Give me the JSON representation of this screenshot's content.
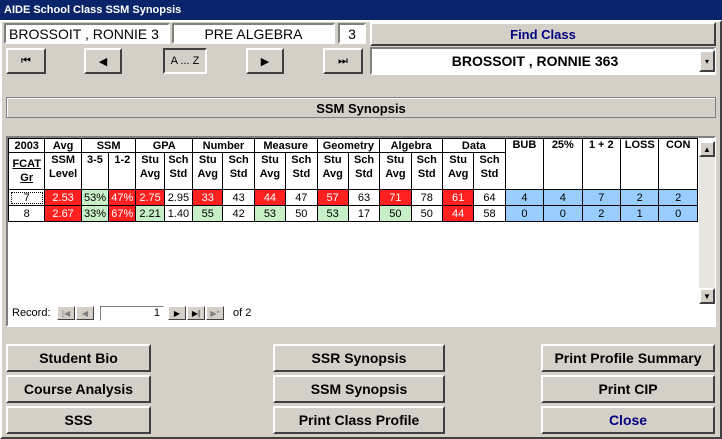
{
  "window": {
    "title": "AIDE School Class SSM Synopsis"
  },
  "header": {
    "student": "BROSSOIT , RONNIE 3",
    "course": "PRE ALGEBRA",
    "period": "3",
    "find_class": "Find Class"
  },
  "nav": {
    "first": "⏮",
    "prev": "◀",
    "alpha": "A ... Z",
    "next": "▶",
    "last": "⏭"
  },
  "student_select": {
    "value": "BROSSOIT , RONNIE 363",
    "arrow": "▾"
  },
  "section": {
    "title": "SSM Synopsis"
  },
  "table": {
    "top_headers": [
      "2003",
      "Avg",
      "SSM",
      "GPA",
      "Number",
      "Measure",
      "Geometry",
      "Algebra",
      "Data",
      "BUB",
      "25%",
      "1 + 2",
      "LOSS",
      "CON"
    ],
    "avg_sub": "SSM\nLevel",
    "fcat": "FCAT\nGr",
    "ssm_sub": [
      "3-5",
      "1-2"
    ],
    "stu_avg": "Stu\nAvg",
    "sch_std": "Sch\nStd",
    "rows": [
      {
        "grade": "7",
        "avg": "2.53",
        "ssm35": "53%",
        "ssm12": "47%",
        "gpa_stu": "2.75",
        "gpa_sch": "2.95",
        "num_stu": "33",
        "num_sch": "43",
        "mea_stu": "44",
        "mea_sch": "47",
        "geo_stu": "57",
        "geo_sch": "63",
        "alg_stu": "71",
        "alg_sch": "78",
        "dat_stu": "61",
        "dat_sch": "64",
        "bub": "4",
        "p25": "4",
        "one_two": "7",
        "loss": "2",
        "con": "2"
      },
      {
        "grade": "8",
        "avg": "2.67",
        "ssm35": "33%",
        "ssm12": "67%",
        "gpa_stu": "2.21",
        "gpa_sch": "1.40",
        "num_stu": "55",
        "num_sch": "42",
        "mea_stu": "53",
        "mea_sch": "50",
        "geo_stu": "53",
        "geo_sch": "17",
        "alg_stu": "50",
        "alg_sch": "50",
        "dat_stu": "44",
        "dat_sch": "58",
        "bub": "0",
        "p25": "0",
        "one_two": "2",
        "loss": "1",
        "con": "0"
      }
    ]
  },
  "record": {
    "label": "Record:",
    "current": "1",
    "of_label": "of",
    "total": "2"
  },
  "buttons": {
    "student_bio": "Student Bio",
    "course_analysis": "Course Analysis",
    "sss": "SSS",
    "ssr_synopsis": "SSR Synopsis",
    "ssm_synopsis": "SSM Synopsis",
    "print_class_profile": "Print Class Profile",
    "print_profile_summary": "Print Profile Summary",
    "print_cip": "Print CIP",
    "close": "Close"
  },
  "colors": {
    "title_bar": "#0a246a",
    "face": "#d4d0c8",
    "bad": "#ff2020",
    "good": "#c8f0c8",
    "count": "#99ccff",
    "link_text": "#000080"
  }
}
